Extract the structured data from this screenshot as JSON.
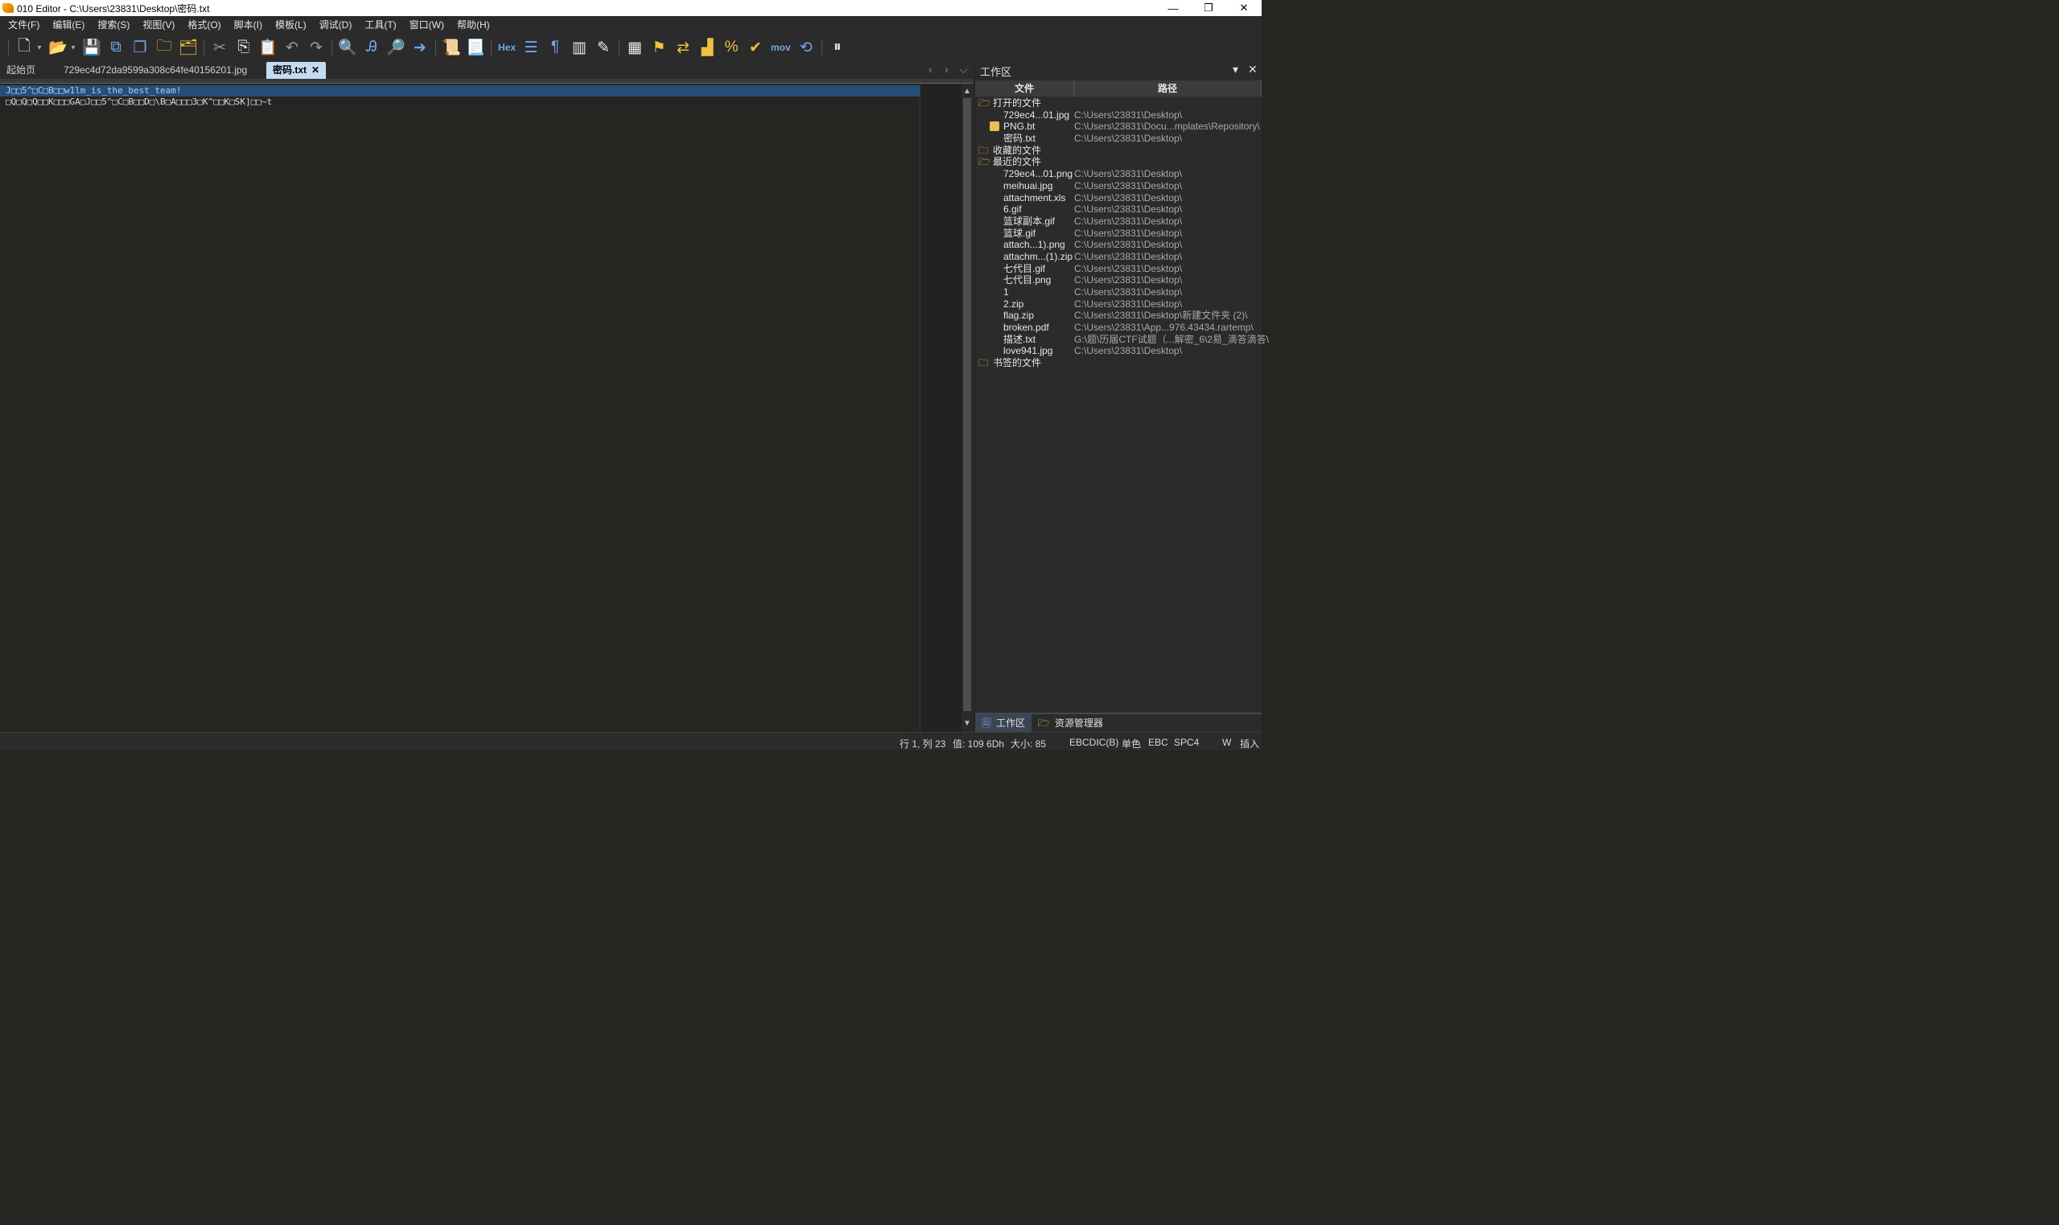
{
  "window": {
    "title": "010 Editor - C:\\Users\\23831\\Desktop\\密码.txt",
    "minimize": "—",
    "restore": "❐",
    "close": "✕"
  },
  "menu": [
    "文件(F)",
    "编辑(E)",
    "搜索(S)",
    "视图(V)",
    "格式(O)",
    "脚本(I)",
    "模板(L)",
    "调试(D)",
    "工具(T)",
    "窗口(W)",
    "帮助(H)"
  ],
  "toolbar": {
    "hex_label": "Hex",
    "mov_label": "mov",
    "icons": [
      "new-file-icon",
      "open-file-icon",
      "save-icon",
      "save-as-icon",
      "save-all-icon",
      "open-folder-icon",
      "workspace-icon",
      "cut-icon",
      "copy-icon",
      "paste-icon",
      "undo-icon",
      "redo-icon",
      "find-icon",
      "replace-icon",
      "find-in-files-icon",
      "goto-icon",
      "run-script-icon",
      "run-template-icon",
      "hex-toggle",
      "columns-icon",
      "pilcrow-icon",
      "ruler-icon",
      "highlight-icon",
      "calculator-icon",
      "inspector-icon",
      "compare-icon",
      "histogram-icon",
      "percent-icon",
      "checksum-icon",
      "mov-label",
      "base-convert-icon",
      "pause-icon"
    ]
  },
  "tabs": [
    {
      "label": "起始页"
    },
    {
      "label": "729ec4d72da9599a308c64fe40156201.jpg"
    },
    {
      "label": "密码.txt",
      "active": true
    }
  ],
  "editor": {
    "lines": [
      "J□□5^□C□B□□w1lm_is_the_best_team!",
      "□Q□Q□Q□□K□□□GA□J□□5^□C□B□□D□\\B□A□□□3□K^□□K□SK]□□~t"
    ]
  },
  "workspace": {
    "title": "工作区",
    "columns": {
      "file": "文件",
      "path": "路径"
    },
    "sections": {
      "open": "打开的文件",
      "favorites": "收藏的文件",
      "recent": "最近的文件",
      "bookmarks": "书签的文件"
    },
    "open_files": [
      {
        "name": "729ec4...01.jpg",
        "path": "C:\\Users\\23831\\Desktop\\"
      },
      {
        "name": "PNG.bt",
        "path": "C:\\Users\\23831\\Docu...mplates\\Repository\\"
      },
      {
        "name": "密码.txt",
        "path": "C:\\Users\\23831\\Desktop\\"
      }
    ],
    "recent_files": [
      {
        "name": "729ec4...01.png",
        "path": "C:\\Users\\23831\\Desktop\\"
      },
      {
        "name": "meihuai.jpg",
        "path": "C:\\Users\\23831\\Desktop\\"
      },
      {
        "name": "attachment.xls",
        "path": "C:\\Users\\23831\\Desktop\\"
      },
      {
        "name": "6.gif",
        "path": "C:\\Users\\23831\\Desktop\\"
      },
      {
        "name": "篮球副本.gif",
        "path": "C:\\Users\\23831\\Desktop\\"
      },
      {
        "name": "篮球.gif",
        "path": "C:\\Users\\23831\\Desktop\\"
      },
      {
        "name": "attach...1).png",
        "path": "C:\\Users\\23831\\Desktop\\"
      },
      {
        "name": "attachm...(1).zip",
        "path": "C:\\Users\\23831\\Desktop\\"
      },
      {
        "name": "七代目.gif",
        "path": "C:\\Users\\23831\\Desktop\\"
      },
      {
        "name": "七代目.png",
        "path": "C:\\Users\\23831\\Desktop\\"
      },
      {
        "name": "1",
        "path": "C:\\Users\\23831\\Desktop\\"
      },
      {
        "name": "2.zip",
        "path": "C:\\Users\\23831\\Desktop\\"
      },
      {
        "name": "flag.zip",
        "path": "C:\\Users\\23831\\Desktop\\新建文件夹 (2)\\"
      },
      {
        "name": "broken.pdf",
        "path": "C:\\Users\\23831\\App...976.43434.rartemp\\"
      },
      {
        "name": "描述.txt",
        "path": "G:\\题\\历届CTF试题（...解密_6\\2易_滴答滴答\\"
      },
      {
        "name": "love941.jpg",
        "path": "C:\\Users\\23831\\Desktop\\"
      }
    ],
    "bottom_tabs": [
      "工作区",
      "资源管理器"
    ]
  },
  "status": {
    "position": "行 1, 列 23",
    "value": "值: 109 6Dh",
    "size": "大小: 85",
    "encoding": "EBCDIC(B)",
    "byte_mode": "单色",
    "charset": "EBC",
    "spacing": "SPC4",
    "write": "W",
    "insert": "插入"
  }
}
